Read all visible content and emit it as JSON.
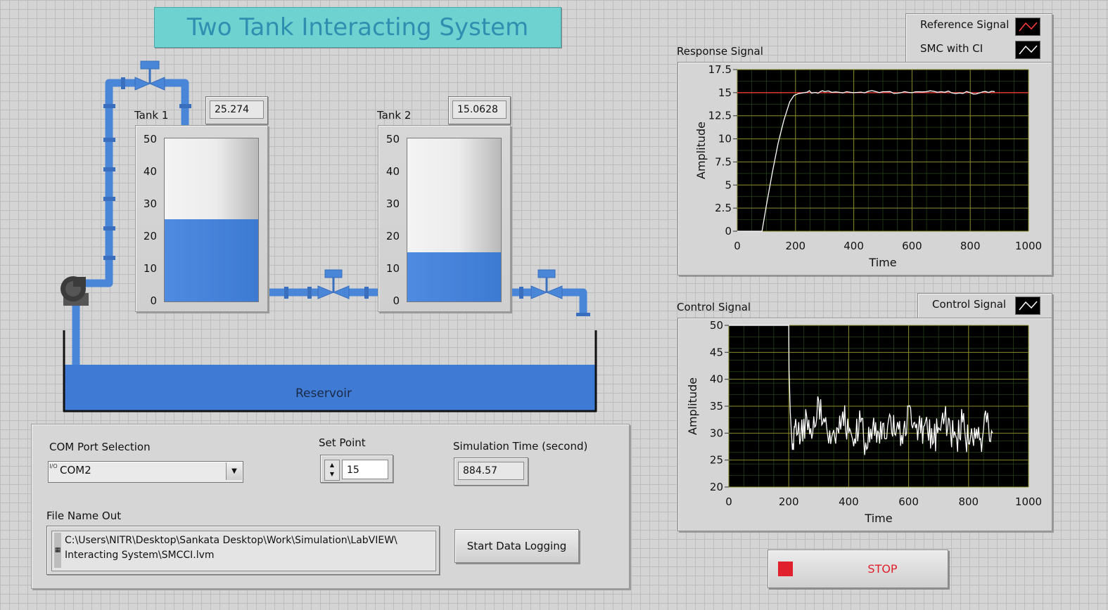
{
  "title": "Two Tank Interacting System",
  "tank1": {
    "label": "Tank 1",
    "value": "25.274",
    "level": 25.274,
    "max": 50,
    "scale": [
      "50",
      "40",
      "30",
      "20",
      "10",
      "0"
    ]
  },
  "tank2": {
    "label": "Tank 2",
    "value": "15.0628",
    "level": 15.0628,
    "max": 50,
    "scale": [
      "50",
      "40",
      "30",
      "20",
      "10",
      "0"
    ]
  },
  "reservoir": {
    "label": "Reservoir"
  },
  "controls": {
    "com_port_label": "COM Port Selection",
    "com_port_value": "COM2",
    "com_port_prefix": "I/O",
    "set_point_label": "Set Point",
    "set_point_value": "15",
    "sim_time_label": "Simulation Time (second)",
    "sim_time_value": "884.57",
    "file_name_label": "File Name Out",
    "file_path_line1": "C:\\Users\\NITR\\Desktop\\Sankata Desktop\\Work\\Simulation\\LabVIEW\\",
    "file_path_line2": "Interacting System\\SMCCI.lvm",
    "start_logging_label": "Start Data Logging",
    "stop_label": "STOP"
  },
  "colors": {
    "pipe": "#4a86d8",
    "water": "#3f7bd4",
    "title_bg": "#6ed2d0",
    "stop_red": "#e0202c"
  },
  "response_graph": {
    "caption": "Response Signal",
    "legend": [
      {
        "name": "Reference Signal",
        "color": "#ff3b3b"
      },
      {
        "name": "SMC with CI",
        "color": "#ffffff"
      }
    ]
  },
  "control_graph": {
    "caption": "Control Signal",
    "legend": [
      {
        "name": "Control Signal",
        "color": "#ffffff"
      }
    ]
  },
  "chart_data": [
    {
      "type": "line",
      "title": "Response Signal",
      "xlabel": "Time",
      "ylabel": "Amplitude",
      "xlim": [
        0,
        1000
      ],
      "ylim": [
        0,
        17.5
      ],
      "x_ticks": [
        "0",
        "200",
        "400",
        "600",
        "800",
        "1000"
      ],
      "y_ticks": [
        "0",
        "2.5",
        "5",
        "7.5",
        "10",
        "12.5",
        "15",
        "17.5"
      ],
      "grid": true,
      "legend_position": "top-right",
      "series": [
        {
          "name": "Reference Signal",
          "x": [
            0,
            1000
          ],
          "y": [
            15,
            15
          ]
        },
        {
          "name": "SMC with CI",
          "x": [
            0,
            85,
            100,
            120,
            140,
            160,
            180,
            195,
            210,
            240,
            300,
            400,
            500,
            600,
            700,
            800,
            884
          ],
          "y": [
            0,
            0,
            2.8,
            6.3,
            9.5,
            12.0,
            14.0,
            14.7,
            14.9,
            15.05,
            15.1,
            15.0,
            15.1,
            15.0,
            15.1,
            15.0,
            15.1
          ]
        }
      ]
    },
    {
      "type": "line",
      "title": "Control Signal",
      "xlabel": "Time",
      "ylabel": "Amplitude",
      "xlim": [
        0,
        1000
      ],
      "ylim": [
        20,
        50
      ],
      "x_ticks": [
        "0",
        "200",
        "400",
        "600",
        "800",
        "1000"
      ],
      "y_ticks": [
        "20",
        "25",
        "30",
        "35",
        "40",
        "45",
        "50"
      ],
      "grid": true,
      "legend_position": "top-right",
      "series": [
        {
          "name": "Control Signal",
          "x": [
            0,
            200,
            201,
            205,
            212,
            220,
            240,
            260,
            280,
            300,
            320,
            340,
            360,
            380,
            400,
            420,
            440,
            460,
            480,
            500,
            520,
            540,
            560,
            580,
            600,
            620,
            640,
            660,
            680,
            700,
            720,
            740,
            760,
            780,
            800,
            820,
            840,
            860,
            880
          ],
          "y": [
            50,
            50,
            42,
            34,
            27,
            31,
            29,
            33,
            30,
            36,
            32,
            28,
            31,
            34,
            30,
            29,
            32,
            27,
            31,
            30,
            29,
            33,
            31,
            28,
            35,
            32,
            30,
            33,
            28,
            31,
            33,
            30,
            29,
            32,
            28,
            31,
            29,
            32,
            30
          ]
        }
      ]
    }
  ]
}
